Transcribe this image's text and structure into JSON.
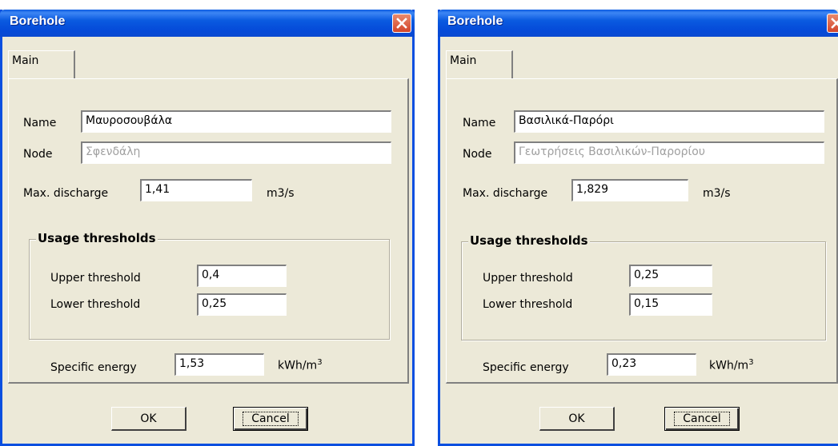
{
  "dialogs": [
    {
      "title": "Borehole",
      "tab": "Main",
      "name_label": "Name",
      "name_value": "Μαυροσουβάλα",
      "node_label": "Node",
      "node_value": "Σφενδάλη",
      "max_discharge_label": "Max. discharge",
      "max_discharge_value": "1,41",
      "max_discharge_unit": "m3/s",
      "usage_thresholds_title": "Usage thresholds",
      "upper_threshold_label": "Upper threshold",
      "upper_threshold_value": "0,4",
      "lower_threshold_label": "Lower threshold",
      "lower_threshold_value": "0,25",
      "specific_energy_label": "Specific energy",
      "specific_energy_value": "1,53",
      "specific_energy_unit": "kWh/m",
      "specific_energy_unit_exp": "3",
      "ok_label": "OK",
      "cancel_label": "Cancel"
    },
    {
      "title": "Borehole",
      "tab": "Main",
      "name_label": "Name",
      "name_value": "Βασιλικά-Παρόρι",
      "node_label": "Node",
      "node_value": "Γεωτρήσεις Βασιλικών-Παρορίου",
      "max_discharge_label": "Max. discharge",
      "max_discharge_value": "1,829",
      "max_discharge_unit": "m3/s",
      "usage_thresholds_title": "Usage thresholds",
      "upper_threshold_label": "Upper threshold",
      "upper_threshold_value": "0,25",
      "lower_threshold_label": "Lower threshold",
      "lower_threshold_value": "0,15",
      "specific_energy_label": "Specific energy",
      "specific_energy_value": "0,23",
      "specific_energy_unit": "kWh/m",
      "specific_energy_unit_exp": "3",
      "ok_label": "OK",
      "cancel_label": "Cancel"
    }
  ],
  "icons": {
    "close": "close-icon"
  },
  "colors": {
    "titlebar": "#0a5ae0",
    "close_button": "#d2452a",
    "dialog_bg": "#ece9d8"
  }
}
